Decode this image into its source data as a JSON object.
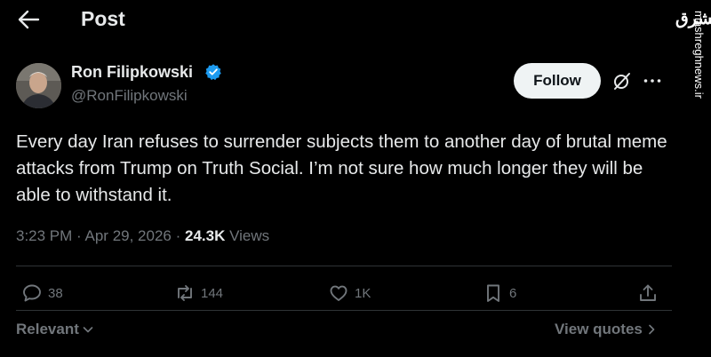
{
  "header": {
    "title": "Post",
    "back_icon": "arrow-left-icon"
  },
  "watermark": {
    "logo": "مشرق",
    "site": "mashreghnews.ir"
  },
  "author": {
    "name": "Ron Filipkowski",
    "handle": "@RonFilipkowski",
    "verified": true,
    "badge_color": "#1d9bf0"
  },
  "follow_label": "Follow",
  "post": {
    "text": "Every day Iran refuses to surrender subjects them to another day of brutal meme attacks from Trump on Truth Social. I’m not sure how much longer they will be able to withstand it.",
    "time": "3:23 PM",
    "sep1": "·",
    "date": "Apr 29, 2026",
    "sep2": "·",
    "views_count": "24.3K",
    "views_label": "Views"
  },
  "actions": {
    "replies": "38",
    "reposts": "144",
    "likes": "1K",
    "bookmarks": "6"
  },
  "footer": {
    "sort_label": "Relevant",
    "quotes_label": "View quotes"
  },
  "colors": {
    "background": "#000000",
    "text": "#e7e9ea",
    "secondary": "#71767b",
    "divider": "#2f3336"
  }
}
